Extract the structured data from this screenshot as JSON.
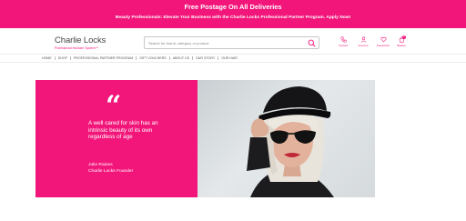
{
  "banner": {
    "headline": "Free Postage On All Deliveries",
    "subline": "Beauty Professionals: Elevate Your Business with the Charlie Locks Professional Partner Program. Apply Now!"
  },
  "brand": {
    "name": "Charlie Locks",
    "tagline": "Professional Haircare System™",
    "accent_color": "#f2157a"
  },
  "search": {
    "placeholder": "Search for brand, category or product",
    "value": ""
  },
  "header_icons": [
    {
      "label": "Contact",
      "icon": "phone-icon"
    },
    {
      "label": "Account",
      "icon": "user-icon"
    },
    {
      "label": "Favourites",
      "icon": "heart-icon"
    },
    {
      "label": "Basket",
      "icon": "basket-icon",
      "count": "0"
    }
  ],
  "nav": {
    "items": [
      "HOME",
      "SHOP",
      "PROFESSIONAL PARTNER PROGRAM",
      "GIFT VOUCHERS",
      "ABOUT US",
      "OUR STORY",
      "OUR HAIR"
    ]
  },
  "hero": {
    "quote_mark": "“",
    "quote": "A well cared for skin has an intrinsic beauty of its own regardless of age",
    "author_name": "Julie Raines",
    "author_role": "Charlie Locks Founder"
  }
}
